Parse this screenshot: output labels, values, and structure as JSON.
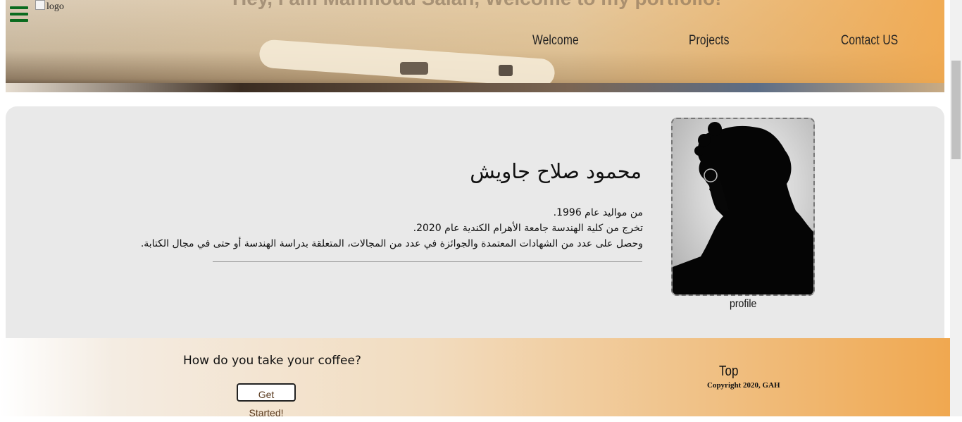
{
  "header": {
    "title": "Hey, I am Mahmoud Salah, Welcome to my portfolio!",
    "logo_alt": "logo",
    "nav": [
      "Welcome",
      "Projects",
      "Contact US"
    ]
  },
  "profile": {
    "name": "محمود صلاح جاويش",
    "bio": [
      "من مواليد عام 1996.",
      "تخرج من كلية الهندسة جامعة الأهرام الكندية عام 2020.",
      "وحصل على عدد من الشهادات المعتمدة والجوائزة في عدد من المجالات، المتعلقة بدراسة الهندسة أو حتى في مجال الكتابة."
    ],
    "photo_caption": "profile"
  },
  "footer": {
    "question": "How do you take your coffee?",
    "cta": "Get Started!",
    "top_link": "Top",
    "copyright": "Copyright 2020, GAH"
  },
  "colors": {
    "menu_icon": "#0a6b1e",
    "footer_accent": "#f0a850",
    "card_bg": "#e9e9e9"
  },
  "icons": {
    "menu": "hamburger-menu-icon"
  }
}
